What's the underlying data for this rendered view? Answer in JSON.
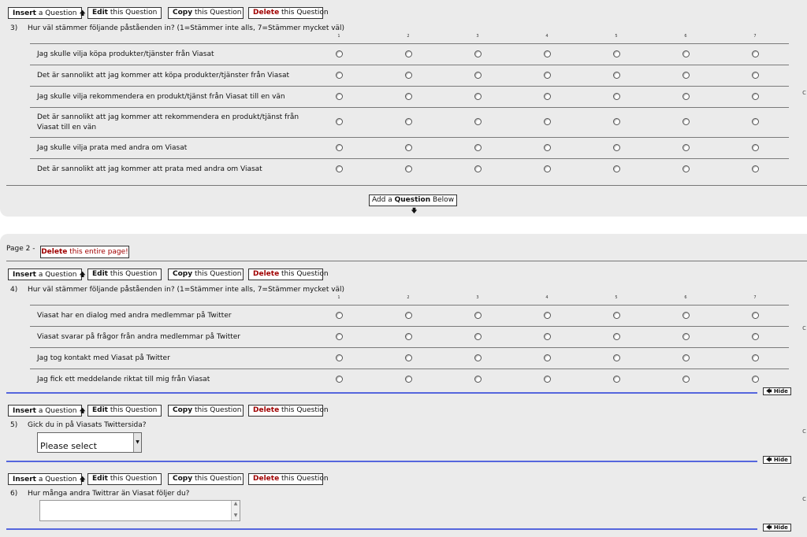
{
  "toolbar": {
    "insert_bold": "Insert",
    "insert_rest": " a Question",
    "edit_bold": "Edit",
    "edit_rest": " this Question",
    "copy_bold": "Copy",
    "copy_rest": " this Question",
    "delete_bold": "Delete",
    "delete_rest": " this Question"
  },
  "scale_labels": [
    "1",
    "2",
    "3",
    "4",
    "5",
    "6",
    "7"
  ],
  "q3": {
    "num": "3)",
    "text": "Hur väl stämmer följande påståenden in? (1=Stämmer inte alls, 7=Stämmer mycket väl)",
    "rows": [
      "Jag skulle vilja köpa produkter/tjänster från Viasat",
      "Det är sannolikt att jag kommer att köpa produkter/tjänster från Viasat",
      "Jag skulle vilja rekommendera en produkt/tjänst från Viasat till en vän",
      "Det är sannolikt att jag kommer att rekommendera en produkt/tjänst från",
      "Viasat till en vän",
      "Jag skulle vilja prata med andra om Viasat",
      "Det är sannolikt att jag kommer att prata med andra om Viasat"
    ]
  },
  "add_below": {
    "pre": "Add a ",
    "bold": "Question",
    "post": " Below"
  },
  "page2": {
    "label": "Page 2 -",
    "delete_bold": "Delete",
    "delete_rest": " this entire page!"
  },
  "q4": {
    "num": "4)",
    "text": "Hur väl stämmer följande påståenden in? (1=Stämmer inte alls, 7=Stämmer mycket väl)",
    "rows": [
      "Viasat har en dialog med andra medlemmar på Twitter",
      "Viasat svarar på frågor från andra medlemmar på Twitter",
      "Jag tog kontakt med Viasat på Twitter",
      "Jag fick ett meddelande riktat till mig från Viasat"
    ]
  },
  "q5": {
    "num": "5)",
    "text": "Gick du in på Viasats Twittersida?",
    "select_value": "Please select"
  },
  "q6": {
    "num": "6)",
    "text": "Hur många andra Twittrar än Viasat följer du?"
  },
  "hide_label": "Hide",
  "edge_mark": "c"
}
